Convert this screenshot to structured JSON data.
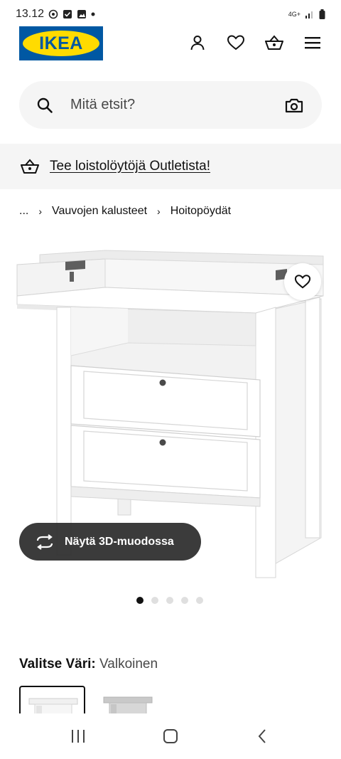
{
  "status_bar": {
    "time": "13.12",
    "network": "4G+",
    "icons": [
      "sync-icon",
      "check-box-icon",
      "image-icon",
      "dot-icon",
      "signal-icon",
      "battery-icon"
    ]
  },
  "header": {
    "logo_text": "IKEA",
    "icons": [
      "user-icon",
      "heart-icon",
      "basket-icon",
      "menu-icon"
    ]
  },
  "search": {
    "placeholder": "Mitä etsit?",
    "icons": [
      "search-icon",
      "camera-icon"
    ]
  },
  "promo": {
    "text": "Tee loistolöytöjä Outletista!",
    "icon": "basket-icon"
  },
  "breadcrumb": {
    "ellipsis": "...",
    "items": [
      "Vauvojen kalusteet",
      "Hoitopöydät"
    ]
  },
  "product": {
    "image_alt_icon": "changing-table-image",
    "favorite_icon": "heart-icon",
    "view_3d_label": "Näytä 3D-muodossa",
    "view_3d_icon": "rotate-3d-icon",
    "carousel": {
      "count": 5,
      "active_index": 0
    }
  },
  "color": {
    "label": "Valitse Väri:",
    "value": "Valkoinen",
    "swatches": [
      "white",
      "grey"
    ]
  },
  "nav_bar": {
    "icons": [
      "recent-apps-icon",
      "home-icon",
      "back-icon"
    ]
  },
  "colors": {
    "ikea_blue": "#0058a3",
    "ikea_yellow": "#ffdb00",
    "surface": "#f5f5f5"
  }
}
